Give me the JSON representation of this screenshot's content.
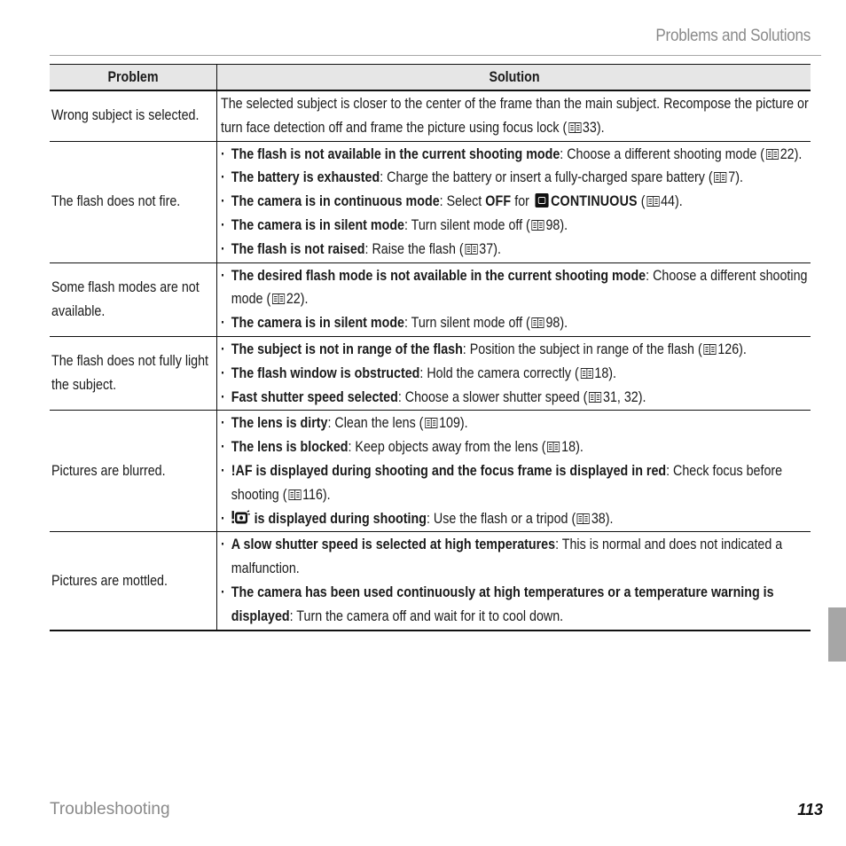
{
  "header": {
    "running_title": "Problems and Solutions"
  },
  "table": {
    "columns": [
      "Problem",
      "Solution"
    ],
    "rows": [
      {
        "problem": "Wrong subject is selected.",
        "solution_text": "The selected subject is closer to the center of the frame than the main subject.  Recompose the picture or turn face detection off and frame the picture using focus lock",
        "solution_ref": "33"
      },
      {
        "problem": "The flash does not fire.",
        "bullets": [
          {
            "bold": "The flash is not available in the current shooting mode",
            "text": ": Choose a different shooting mode (",
            "ref": "22",
            "end": ")."
          },
          {
            "bold": "The battery is exhausted",
            "text": ": Charge the battery or insert a fully-charged spare battery (",
            "ref": "7",
            "end": ")."
          },
          {
            "bold": "The camera is in continuous mode",
            "text": ": Select ",
            "option": "OFF",
            "for": " for ",
            "menu_icon": "continuous-mode-icon",
            "menu_item": "CONTINUOUS",
            "pre_ref": " (",
            "ref": "44",
            "end": ")."
          },
          {
            "bold": "The camera is in silent mode",
            "text": ": Turn silent mode off (",
            "ref": "98",
            "end": ")."
          },
          {
            "bold": "The flash is not raised",
            "text": ": Raise the flash (",
            "ref": "37",
            "end": ")."
          }
        ]
      },
      {
        "problem": "Some flash modes are not available.",
        "bullets": [
          {
            "bold": "The desired flash mode is not available in the current shooting mode",
            "text": ": Choose a different shooting mode (",
            "ref": "22",
            "end": ")."
          },
          {
            "bold": "The camera is in silent mode",
            "text": ": Turn silent mode off (",
            "ref": "98",
            "end": ")."
          }
        ]
      },
      {
        "problem": "The flash does not fully light the subject.",
        "bullets": [
          {
            "bold": "The subject is not in range of the flash",
            "text": ": Position the subject in range of the flash (",
            "ref": "126",
            "end": ")."
          },
          {
            "bold": "The flash window is obstructed",
            "text": ": Hold the camera correctly (",
            "ref": "18",
            "end": ")."
          },
          {
            "bold": "Fast shutter speed selected",
            "text": ": Choose a slower shutter speed (",
            "ref": "31, 32",
            "end": ")."
          }
        ]
      },
      {
        "problem": "Pictures are blurred.",
        "bullets": [
          {
            "bold": "The lens is dirty",
            "text": ": Clean the lens (",
            "ref": "109",
            "end": ")."
          },
          {
            "bold": "The lens is blocked",
            "text": ": Keep objects away from the lens (",
            "ref": "18",
            "end": ")."
          },
          {
            "bold_icon": "!",
            "bold": "AF is displayed during shooting and the focus frame is displayed in red",
            "text": ": Check focus before shooting (",
            "ref": "116",
            "end": ")."
          },
          {
            "bold_icon": "camera-shake-warning-icon",
            "bold": " is displayed during shooting",
            "text": ": Use the flash or a tripod (",
            "ref": "38",
            "end": ")."
          }
        ]
      },
      {
        "problem": "Pictures are mottled.",
        "bullets": [
          {
            "bold": "A slow shutter speed is selected at high temperatures",
            "text": ": This is normal and does not indicated a malfunction."
          },
          {
            "bold": "The camera has been used continuously at high temperatures or a temperature warning is displayed",
            "text": ": Turn the camera off and wait for it to cool down."
          }
        ]
      }
    ]
  },
  "footer": {
    "section": "Troubleshooting",
    "page_number": "113"
  },
  "colors": {
    "header_bg": "#e6e6e6",
    "muted_text": "#8a8a8a",
    "side_tab": "#a6a6a6"
  }
}
